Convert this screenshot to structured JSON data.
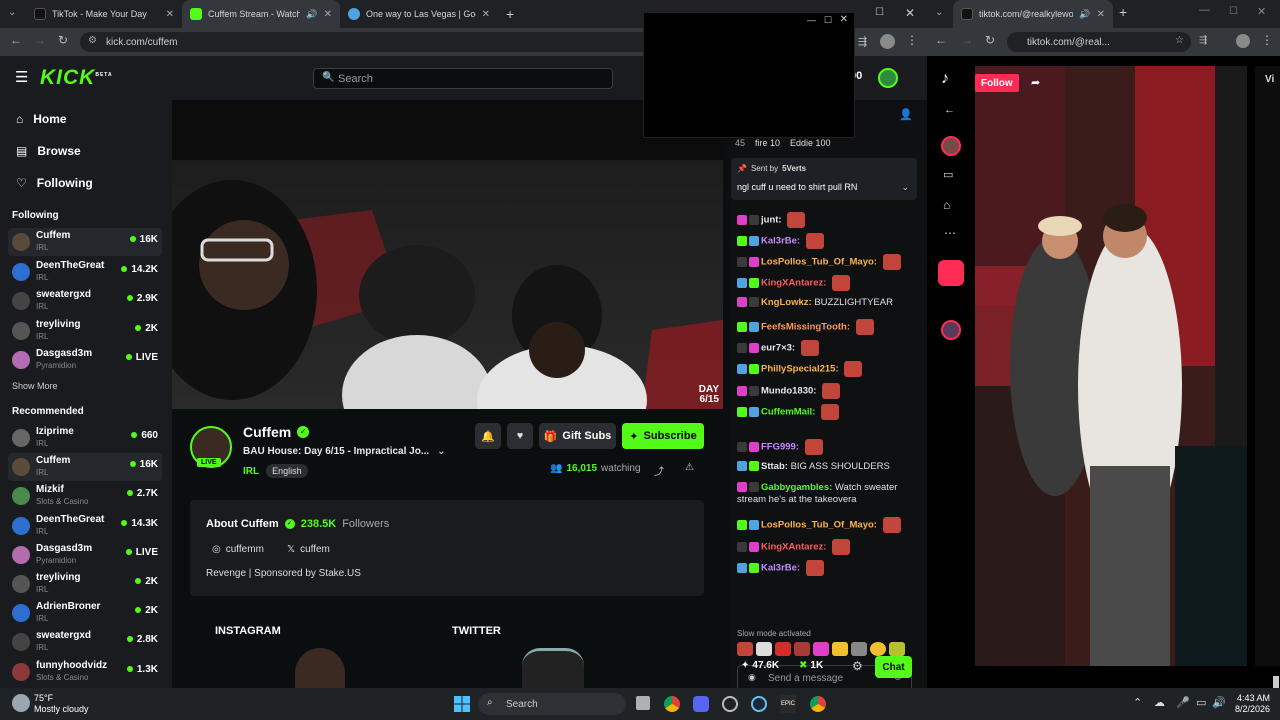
{
  "browser": {
    "tabs": [
      {
        "title": "TikTok - Make Your Day",
        "fav": "#111",
        "active": false
      },
      {
        "title": "Cuffem Stream - Watch Live",
        "fav": "#53fc18",
        "active": true
      },
      {
        "title": "One way to Las Vegas | Google",
        "fav": "#4fa3e0",
        "active": false
      }
    ],
    "new_tab": "+",
    "url": "kick.com/cuffem"
  },
  "kick": {
    "logo": "KICK",
    "logo_sup": "BETA",
    "search_placeholder": "Search",
    "nav": [
      {
        "label": "Home",
        "icon": "home-icon"
      },
      {
        "label": "Browse",
        "icon": "browse-icon"
      },
      {
        "label": "Following",
        "icon": "heart-icon"
      }
    ],
    "following_title": "Following",
    "following": [
      {
        "name": "Cuffem",
        "cat": "IRL",
        "viewers": "16K",
        "color": "#5a4a3a"
      },
      {
        "name": "DeenTheGreat",
        "cat": "IRL",
        "viewers": "14.2K",
        "color": "#2d6fd1"
      },
      {
        "name": "sweatergxd",
        "cat": "IRL",
        "viewers": "2.9K",
        "color": "#444"
      },
      {
        "name": "treyliving",
        "cat": "IRL",
        "viewers": "2K",
        "color": "#555"
      },
      {
        "name": "Dasgasd3m",
        "cat": "Pyramidion",
        "viewers": "LIVE",
        "color": "#b46bb0"
      }
    ],
    "show_more": "Show More",
    "recommended_title": "Recommended",
    "recommended": [
      {
        "name": "Iziprime",
        "cat": "IRL",
        "viewers": "660",
        "color": "#666"
      },
      {
        "name": "Cuffem",
        "cat": "IRL",
        "viewers": "16K",
        "color": "#5a4a3a"
      },
      {
        "name": "Mizkif",
        "cat": "Slots & Casino",
        "viewers": "2.7K",
        "color": "#4a8a4a"
      },
      {
        "name": "DeenTheGreat",
        "cat": "IRL",
        "viewers": "14.3K",
        "color": "#2d6fd1"
      },
      {
        "name": "Dasgasd3m",
        "cat": "Pyramidion",
        "viewers": "LIVE",
        "color": "#b46bb0"
      },
      {
        "name": "treyliving",
        "cat": "IRL",
        "viewers": "2K",
        "color": "#555"
      },
      {
        "name": "AdrienBroner",
        "cat": "IRL",
        "viewers": "2K",
        "color": "#2d6fd1"
      },
      {
        "name": "sweatergxd",
        "cat": "IRL",
        "viewers": "2.8K",
        "color": "#444"
      },
      {
        "name": "funnyhoodvidz",
        "cat": "Slots & Casino",
        "viewers": "1.3K",
        "color": "#8a3a3a"
      }
    ],
    "video": {
      "day_label": "DAY",
      "day_value": "6/15"
    },
    "streamer": {
      "name": "Cuffem",
      "title": "BAU House: Day 6/15 - Impractical Jo...",
      "live": "LIVE",
      "category": "IRL",
      "language": "English",
      "watching_count": "16,015",
      "watching_label": "watching",
      "gift_subs": "Gift Subs",
      "subscribe": "Subscribe"
    },
    "about": {
      "title": "About Cuffem",
      "followers_count": "238.5K",
      "followers_label": "Followers",
      "instagram": "cuffemm",
      "twitter": "cuffem",
      "bio": "Revenge | Sponsored by Stake.US",
      "panel_instagram": "INSTAGRAM",
      "panel_twitter": "TWITTER"
    },
    "chat": {
      "top_gifters": [
        {
          "pos": "45",
          "name": ""
        },
        {
          "pos": "",
          "name": "fire 10"
        },
        {
          "pos": "",
          "name": "Eddie 100"
        }
      ],
      "pinned_prefix": "Sent by",
      "pinned_user": "5Verts",
      "pinned_text": "ngl cuff u need to shirt pull RN",
      "messages": [
        {
          "user": "junt:",
          "color": "#e8e8e8",
          "text": ""
        },
        {
          "user": "Kal3rBe:",
          "color": "#c38cff",
          "text": ""
        },
        {
          "user": "LosPollos_Tub_Of_Mayo:",
          "color": "#ffb347",
          "text": ""
        },
        {
          "user": "KingXAntarez:",
          "color": "#ff5c5c",
          "text": ""
        },
        {
          "user": "KngLowkz:",
          "color": "#ffb347",
          "text": "BUZZLIGHTYEAR"
        },
        {
          "user": "FeefsMissingTooth:",
          "color": "#ff9a5c",
          "text": ""
        },
        {
          "user": "eur7×3:",
          "color": "#e8e8e8",
          "text": ""
        },
        {
          "user": "PhillySpecial215:",
          "color": "#ffb347",
          "text": ""
        },
        {
          "user": "Mundo1830:",
          "color": "#e8e8e8",
          "text": ""
        },
        {
          "user": "CuffemMail:",
          "color": "#53fc18",
          "text": ""
        },
        {
          "user": "FFG999:",
          "color": "#c38cff",
          "text": ""
        },
        {
          "user": "Sttab:",
          "color": "#e8e8e8",
          "text": "BIG ASS SHOULDERS"
        },
        {
          "user": "Gabbygambles:",
          "color": "#53fc18",
          "text": "Watch sweater stream he's at the takeovera"
        },
        {
          "user": "LosPollos_Tub_Of_Mayo:",
          "color": "#ffb347",
          "text": ""
        },
        {
          "user": "KingXAntarez:",
          "color": "#ff5c5c",
          "text": ""
        },
        {
          "user": "Kal3rBe:",
          "color": "#c38cff",
          "text": ""
        }
      ],
      "slow_mode": "Slow mode activated",
      "input_placeholder": "Send a message",
      "points": "47.6K",
      "kick_points": "1K",
      "chat_button": "Chat"
    }
  },
  "tiktok": {
    "tab_title": "tiktok.com/@realkylewong",
    "url": "tiktok.com/@real...",
    "follow": "Follow",
    "side_label": "Vi"
  },
  "taskbar": {
    "temp": "75°F",
    "weather": "Mostly cloudy",
    "search": "Search",
    "time": "4:43 AM",
    "date": "8/2/2026"
  }
}
